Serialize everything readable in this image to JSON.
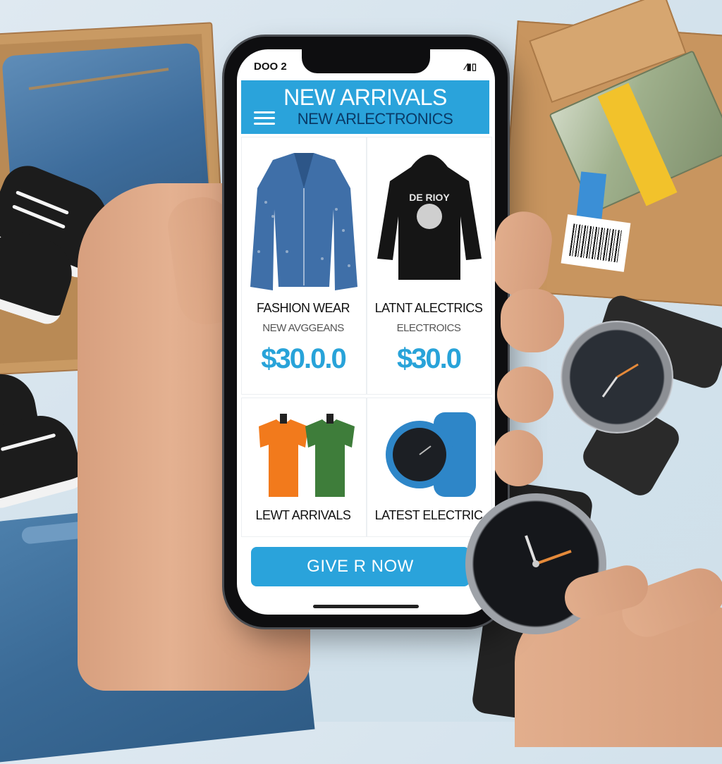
{
  "status_bar": {
    "left": "DOO 2",
    "right": "∕▮▯"
  },
  "header": {
    "title": "NEW ARRIVALS",
    "subtitle": "NEW ARLECTRONICS",
    "menu_icon": "hamburger-menu-icon"
  },
  "products": [
    {
      "name": "FASHION WEAR",
      "sub": "NEW AVGGEANS",
      "price": "$30.0.0",
      "image": "studded-denim-jacket"
    },
    {
      "name": "LATNT ALECTRICS",
      "sub": "ELECTROICS",
      "price": "$30.0",
      "image": "black-hoodie"
    },
    {
      "name": "LEWT ARRIVALS",
      "image": "orange-and-green-tshirts"
    },
    {
      "name": "LATEST ELECTRIC",
      "image": "blue-smartwatch"
    }
  ],
  "cta": {
    "label": "GIVE R NOW"
  },
  "colors": {
    "accent": "#2aa3db",
    "price": "#28a3d9",
    "dark_text": "#0a3a66"
  }
}
